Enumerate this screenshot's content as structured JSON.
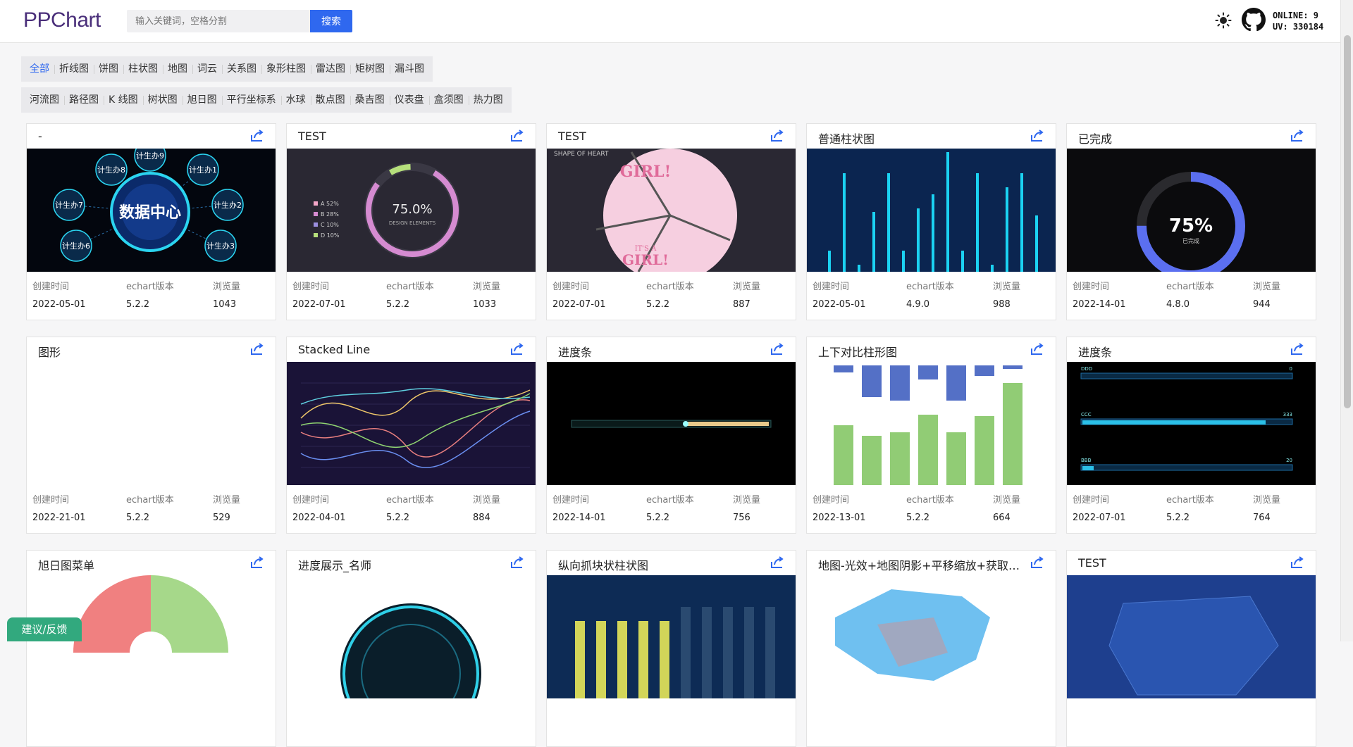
{
  "header": {
    "logo": "PPChart",
    "search_placeholder": "输入关键词，空格分割",
    "search_button": "搜索",
    "online": "ONLINE: 9",
    "uv": "UV: 330184"
  },
  "filters": {
    "row1": [
      "全部",
      "折线图",
      "饼图",
      "柱状图",
      "地图",
      "词云",
      "关系图",
      "象形柱图",
      "雷达图",
      "矩树图",
      "漏斗图"
    ],
    "row2": [
      "河流图",
      "路径图",
      "K 线图",
      "树状图",
      "旭日图",
      "平行坐标系",
      "水球",
      "散点图",
      "桑吉图",
      "仪表盘",
      "盒须图",
      "热力图"
    ],
    "active": "全部"
  },
  "labels": {
    "created": "创建时间",
    "version": "echart版本",
    "views": "浏览量"
  },
  "cards": [
    {
      "title": "-",
      "date": "2022-05-01",
      "version": "5.2.2",
      "views": "1043",
      "thumb": "hub"
    },
    {
      "title": "TEST",
      "date": "2022-07-01",
      "version": "5.2.2",
      "views": "1033",
      "thumb": "ring"
    },
    {
      "title": "TEST",
      "date": "2022-07-01",
      "version": "5.2.2",
      "views": "887",
      "thumb": "pie"
    },
    {
      "title": "普通柱状图",
      "date": "2022-05-01",
      "version": "4.9.0",
      "views": "988",
      "thumb": "bars"
    },
    {
      "title": "已完成",
      "date": "2022-14-01",
      "version": "4.8.0",
      "views": "944",
      "thumb": "gauge"
    },
    {
      "title": "图形",
      "date": "2022-21-01",
      "version": "5.2.2",
      "views": "529",
      "thumb": "blank"
    },
    {
      "title": "Stacked Line",
      "date": "2022-04-01",
      "version": "5.2.2",
      "views": "884",
      "thumb": "lines"
    },
    {
      "title": "进度条",
      "date": "2022-14-01",
      "version": "5.2.2",
      "views": "756",
      "thumb": "progress"
    },
    {
      "title": "上下对比柱形图",
      "date": "2022-13-01",
      "version": "5.2.2",
      "views": "664",
      "thumb": "updown"
    },
    {
      "title": "进度条",
      "date": "2022-07-01",
      "version": "5.2.2",
      "views": "764",
      "thumb": "hbars"
    },
    {
      "title": "旭日图菜单",
      "thumb": "sunburst"
    },
    {
      "title": "进度展示_名师",
      "thumb": "arc"
    },
    {
      "title": "纵向抓块状柱状图",
      "thumb": "blocks"
    },
    {
      "title": "地图-光效+地图阴影+平移缩放+获取坐…",
      "thumb": "map"
    },
    {
      "title": "TEST",
      "thumb": "bluemap"
    }
  ],
  "thumb_text": {
    "hub_center": "数据中心",
    "hub_nodes": [
      "计生办9",
      "计生办8",
      "计生办1",
      "计生办7",
      "计生办2",
      "计生办6",
      "计生办3"
    ],
    "ring_value": "75.0%",
    "ring_sub": "DESIGN ELEMENTS",
    "ring_legend": [
      "A 52%",
      "B 28%",
      "C 10%",
      "D 10%"
    ],
    "pie_title": "SHAPE OF HEART",
    "pie_text": [
      "GIRL!",
      "IT'S A",
      "GIRL!"
    ],
    "gauge_value": "75%",
    "gauge_sub": "已完成",
    "hbar_labels": [
      "DDD",
      "CCC",
      "BBB"
    ],
    "hbar_values": [
      "0",
      "333",
      "20"
    ]
  },
  "feedback": "建议/反馈"
}
